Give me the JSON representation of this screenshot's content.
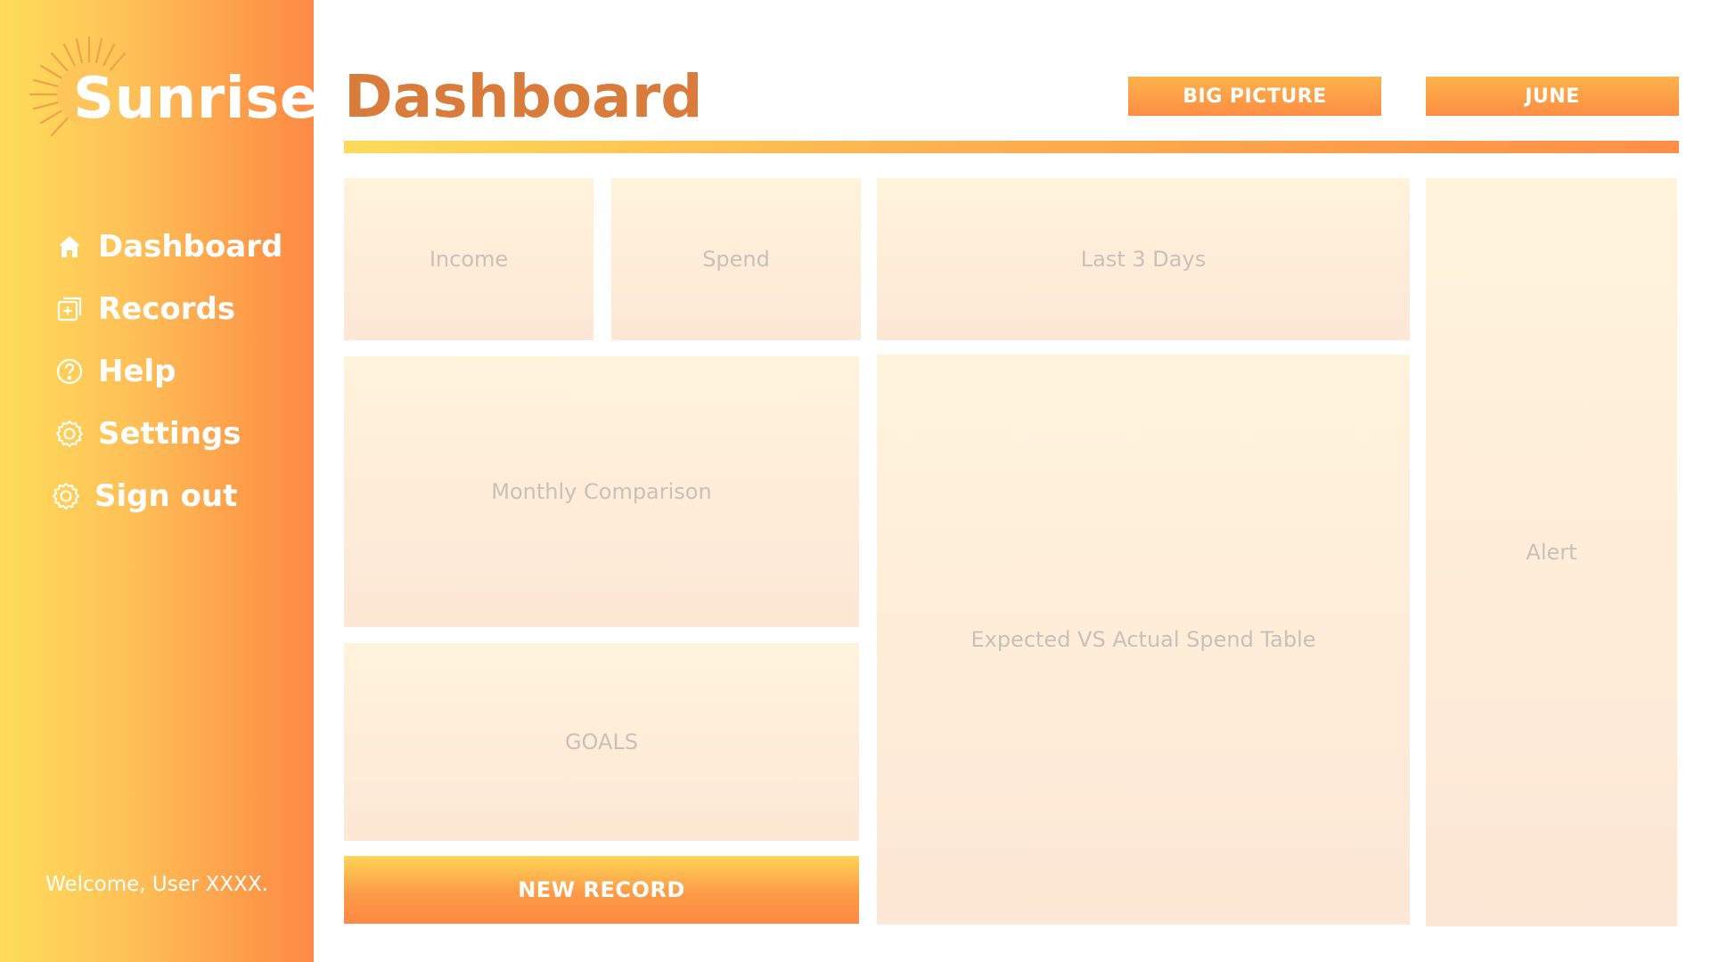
{
  "brand": {
    "name": "Sunrise",
    "icon": "sun-icon"
  },
  "sidebar": {
    "items": [
      {
        "label": "Dashboard",
        "icon": "home-icon"
      },
      {
        "label": "Records",
        "icon": "add-record-icon"
      },
      {
        "label": "Help",
        "icon": "help-circle-icon"
      },
      {
        "label": "Settings",
        "icon": "gear-icon"
      },
      {
        "label": "Sign out",
        "icon": "gear-icon"
      }
    ],
    "welcome": "Welcome, User XXXX."
  },
  "header": {
    "title": "Dashboard",
    "big_picture_label": "BIG PICTURE",
    "month_label": "JUNE"
  },
  "cards": {
    "income": "Income",
    "spend": "Spend",
    "last_3_days": "Last 3 Days",
    "monthly_comparison": "Monthly Comparison",
    "goals": "GOALS",
    "expected_vs_actual": "Expected VS Actual Spend Table",
    "alert": "Alert"
  },
  "actions": {
    "new_record_label": "NEW RECORD"
  },
  "colors": {
    "accent_orange": "#fd8a45",
    "accent_yellow": "#fedd5a",
    "title": "#d97b3b",
    "card_text": "#c9c0b7"
  }
}
